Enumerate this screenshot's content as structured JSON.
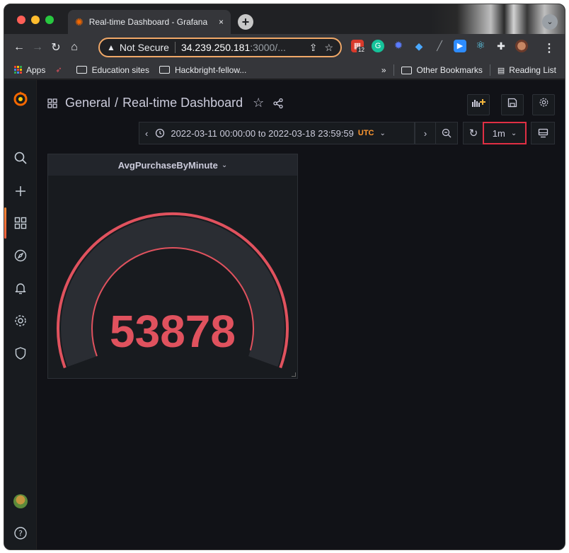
{
  "browser": {
    "tab_title": "Real-time Dashboard - Grafana",
    "tab_close": "×",
    "new_tab": "+",
    "url_security": "Not Secure",
    "url_host": "34.239.250.181",
    "url_rest": ":3000/...",
    "ext_badge": "12",
    "bookmarks": {
      "apps": "Apps",
      "education": "Education sites",
      "hackbright": "Hackbright-fellow...",
      "overflow": "»",
      "other": "Other Bookmarks",
      "reading": "Reading List"
    }
  },
  "grafana": {
    "breadcrumb_folder": "General",
    "breadcrumb_sep": "/",
    "dashboard_title": "Real-time Dashboard",
    "time_range": "2022-03-11 00:00:00 to 2022-03-18 23:59:59",
    "timezone": "UTC",
    "refresh_interval": "1m",
    "panel": {
      "title": "AvgPurchaseByMinute",
      "value": "53878",
      "value_color": "#e0525e",
      "gauge_fill_fraction": 0.98
    }
  },
  "colors": {
    "accent_orange": "#f46800",
    "highlight_red": "#e02f44",
    "gauge_red": "#e0525e"
  }
}
